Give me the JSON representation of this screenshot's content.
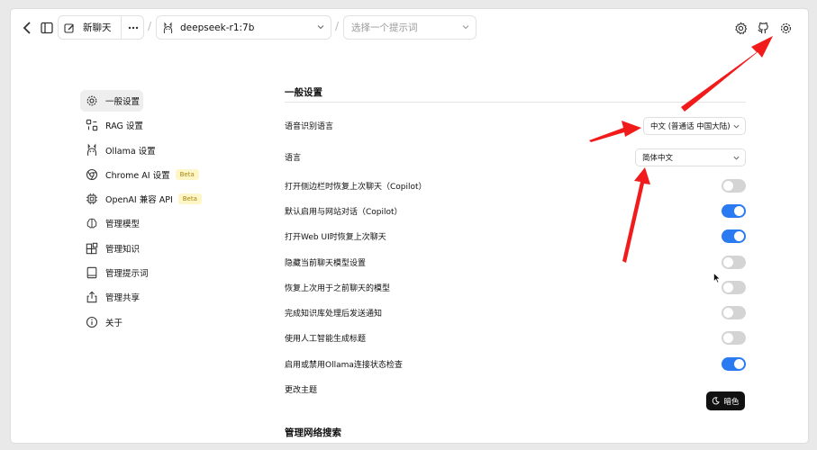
{
  "topbar": {
    "new_chat_label": "新聊天",
    "model_selected": "deepseek-r1:7b",
    "prompt_placeholder": "选择一个提示词"
  },
  "nav": {
    "items": [
      {
        "label": "一般设置",
        "icon": "settings-gear-icon",
        "active": true
      },
      {
        "label": "RAG 设置",
        "icon": "rag-icon"
      },
      {
        "label": "Ollama 设置",
        "icon": "ollama-icon"
      },
      {
        "label": "Chrome AI 设置",
        "icon": "chrome-icon",
        "badge": "Beta"
      },
      {
        "label": "OpenAI 兼容 API",
        "icon": "cpu-chip-icon",
        "badge": "Beta"
      },
      {
        "label": "管理模型",
        "icon": "brain-icon"
      },
      {
        "label": "管理知识",
        "icon": "blocks-icon"
      },
      {
        "label": "管理提示词",
        "icon": "book-icon"
      },
      {
        "label": "管理共享",
        "icon": "share-icon"
      },
      {
        "label": "关于",
        "icon": "info-icon"
      }
    ]
  },
  "general": {
    "title": "一般设置",
    "speech_lang_label": "语音识别语言",
    "speech_lang_value": "中文 (普通话 中国大陆)",
    "language_label": "语言",
    "language_value": "简体中文",
    "toggles": [
      {
        "label": "打开侧边栏时恢复上次聊天（Copilot）",
        "on": false
      },
      {
        "label": "默认启用与网站对话（Copilot）",
        "on": true
      },
      {
        "label": "打开Web UI时恢复上次聊天",
        "on": true
      },
      {
        "label": "隐藏当前聊天模型设置",
        "on": false
      },
      {
        "label": "恢复上次用于之前聊天的模型",
        "on": false
      },
      {
        "label": "完成知识库处理后发送通知",
        "on": false
      },
      {
        "label": "使用人工智能生成标题",
        "on": false
      },
      {
        "label": "启用或禁用Ollama连接状态检查",
        "on": true
      }
    ],
    "theme_label": "更改主题",
    "theme_button": "暗色"
  },
  "network": {
    "title": "管理网络搜索"
  },
  "colors": {
    "toggle_on": "#2a7bf2",
    "toggle_off": "#d4d4d4",
    "annotation_arrow": "#f21b1b",
    "beta_bg": "#fef6c6"
  }
}
